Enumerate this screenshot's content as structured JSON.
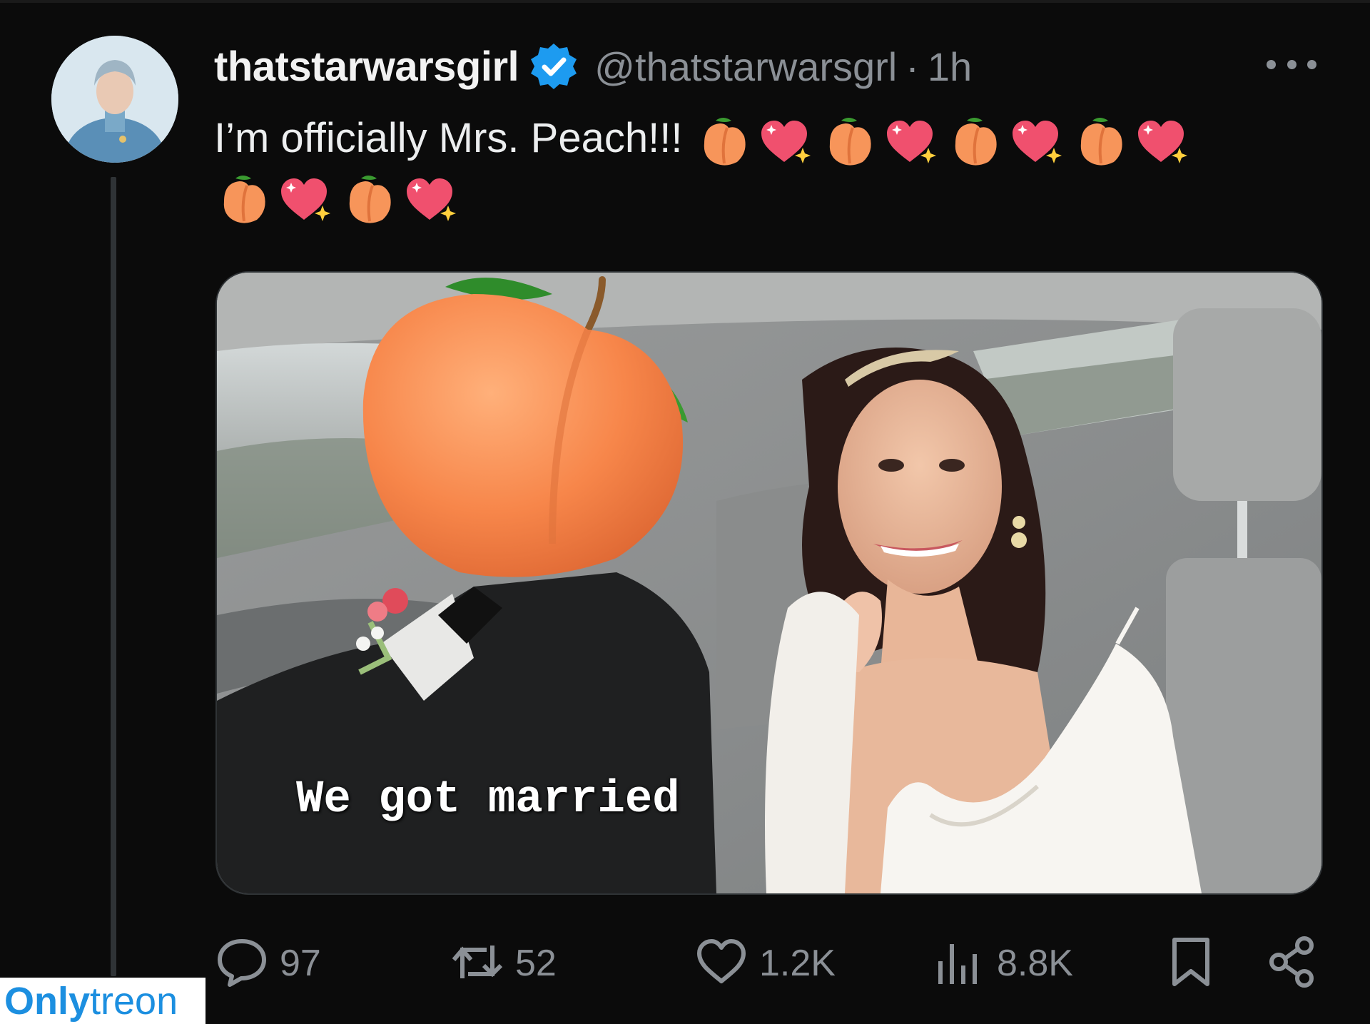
{
  "tweet": {
    "display_name": "thatstarwarsgirl",
    "handle": "@thatstarwarsgrl",
    "separator": "·",
    "time": "1h",
    "text": "I’m officially Mrs. Peach!!!",
    "emoji_line1": [
      "peach-emoji",
      "sparkling-heart-emoji",
      "peach-emoji",
      "sparkling-heart-emoji",
      "peach-emoji",
      "sparkling-heart-emoji",
      "peach-emoji",
      "sparkling-heart-emoji"
    ],
    "emoji_line2": [
      "peach-emoji",
      "sparkling-heart-emoji",
      "peach-emoji",
      "sparkling-heart-emoji"
    ],
    "media_caption": "We got married"
  },
  "actions": {
    "replies": "97",
    "reposts": "52",
    "likes": "1.2K",
    "views": "8.8K"
  },
  "icons": {
    "reply": "speech-bubble-icon",
    "repost": "repost-arrows-icon",
    "like": "heart-icon",
    "views": "bar-chart-icon",
    "bookmark": "bookmark-icon",
    "share": "share-icon",
    "more": "more-dots-icon",
    "verified": "verified-badge-icon"
  },
  "watermark": {
    "part1": "Only",
    "part2": "treon"
  },
  "colors": {
    "background": "#0b0b0b",
    "verified_blue": "#1d9bf0",
    "muted_text": "#8b9096",
    "peach": "#f7955a",
    "heart": "#f0506e"
  }
}
